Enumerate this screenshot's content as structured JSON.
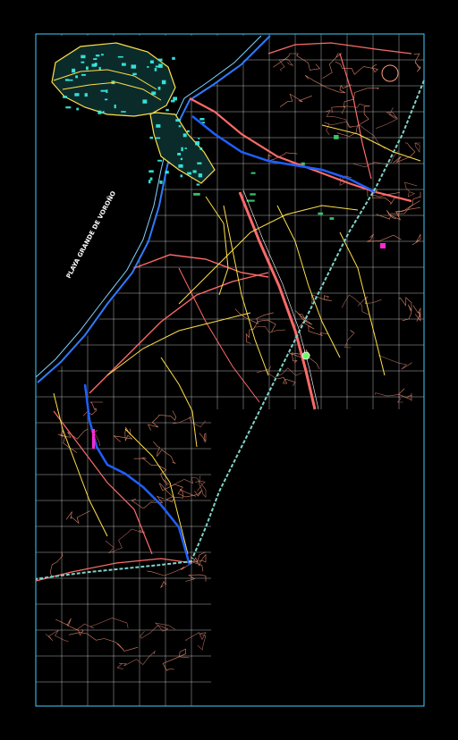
{
  "map": {
    "bay_label": "PLAYA GRANDE DE VOROÑO",
    "colors": {
      "background": "#000000",
      "frame": "#3fd0ff",
      "grid": "#ffffff",
      "coastline": "#2f7bff",
      "roads": "#ff6a6a",
      "contours": "#ff9a7a",
      "streets": "#ffe14a",
      "buildings": "#37f5e8",
      "path": "#7fd3c8",
      "river": "#1f5fff",
      "marker": "#66ff66",
      "accent": "#ff2ad4"
    }
  }
}
